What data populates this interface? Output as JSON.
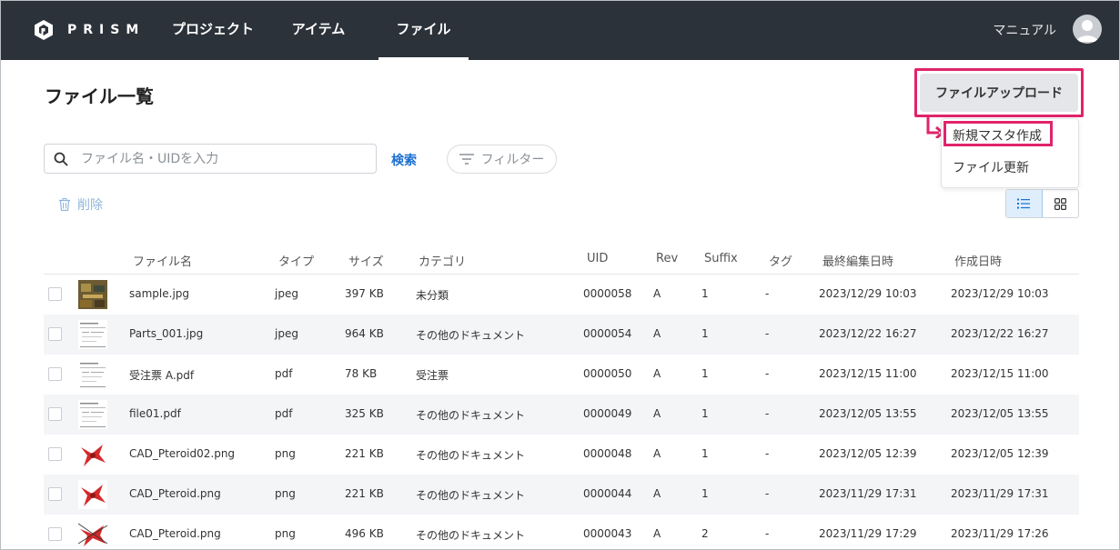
{
  "header": {
    "logo_text": "PRISM",
    "nav": [
      {
        "label": "プロジェクト"
      },
      {
        "label": "アイテム"
      },
      {
        "label": "ファイル"
      }
    ],
    "user_label": "マニュアル"
  },
  "page": {
    "title": "ファイル一覧",
    "upload_button": "ファイルアップロード",
    "dropdown": [
      "新規マスタ作成",
      "ファイル更新"
    ],
    "search_placeholder": "ファイル名・UIDを入力",
    "search_button": "検索",
    "filter_button": "フィルター",
    "delete_button": "削除"
  },
  "colors": {
    "header_bg": "#2c323a",
    "highlight": "#e0246b",
    "link": "#1a6fd1"
  },
  "table": {
    "columns": [
      "ファイル名",
      "タイプ",
      "サイズ",
      "カテゴリ",
      "UID",
      "Rev",
      "Suffix",
      "タグ",
      "最終編集日時",
      "作成日時"
    ],
    "rows": [
      {
        "name": "sample.jpg",
        "type": "jpeg",
        "size": "397 KB",
        "category": "未分類",
        "uid": "0000058",
        "rev": "A",
        "suffix": "1",
        "tag": "-",
        "edited": "2023/12/29 10:03",
        "created": "2023/12/29 10:03",
        "thumb": "photo"
      },
      {
        "name": "Parts_001.jpg",
        "type": "jpeg",
        "size": "964 KB",
        "category": "その他のドキュメント",
        "uid": "0000054",
        "rev": "A",
        "suffix": "1",
        "tag": "-",
        "edited": "2023/12/22 16:27",
        "created": "2023/12/22 16:27",
        "thumb": "doc"
      },
      {
        "name": "受注票 A.pdf",
        "type": "pdf",
        "size": "78 KB",
        "category": "受注票",
        "uid": "0000050",
        "rev": "A",
        "suffix": "1",
        "tag": "-",
        "edited": "2023/12/15 11:00",
        "created": "2023/12/15 11:00",
        "thumb": "doc"
      },
      {
        "name": "file01.pdf",
        "type": "pdf",
        "size": "325 KB",
        "category": "その他のドキュメント",
        "uid": "0000049",
        "rev": "A",
        "suffix": "1",
        "tag": "-",
        "edited": "2023/12/05 13:55",
        "created": "2023/12/05 13:55",
        "thumb": "doc"
      },
      {
        "name": "CAD_Pteroid02.png",
        "type": "png",
        "size": "221 KB",
        "category": "その他のドキュメント",
        "uid": "0000048",
        "rev": "A",
        "suffix": "1",
        "tag": "-",
        "edited": "2023/12/05 12:39",
        "created": "2023/12/05 12:39",
        "thumb": "red"
      },
      {
        "name": "CAD_Pteroid.png",
        "type": "png",
        "size": "221 KB",
        "category": "その他のドキュメント",
        "uid": "0000044",
        "rev": "A",
        "suffix": "1",
        "tag": "-",
        "edited": "2023/11/29 17:31",
        "created": "2023/11/29 17:31",
        "thumb": "red"
      },
      {
        "name": "CAD_Pteroid.png",
        "type": "png",
        "size": "496 KB",
        "category": "その他のドキュメント",
        "uid": "0000043",
        "rev": "A",
        "suffix": "2",
        "tag": "-",
        "edited": "2023/11/29 17:29",
        "created": "2023/11/29 17:26",
        "thumb": "redline"
      }
    ]
  }
}
